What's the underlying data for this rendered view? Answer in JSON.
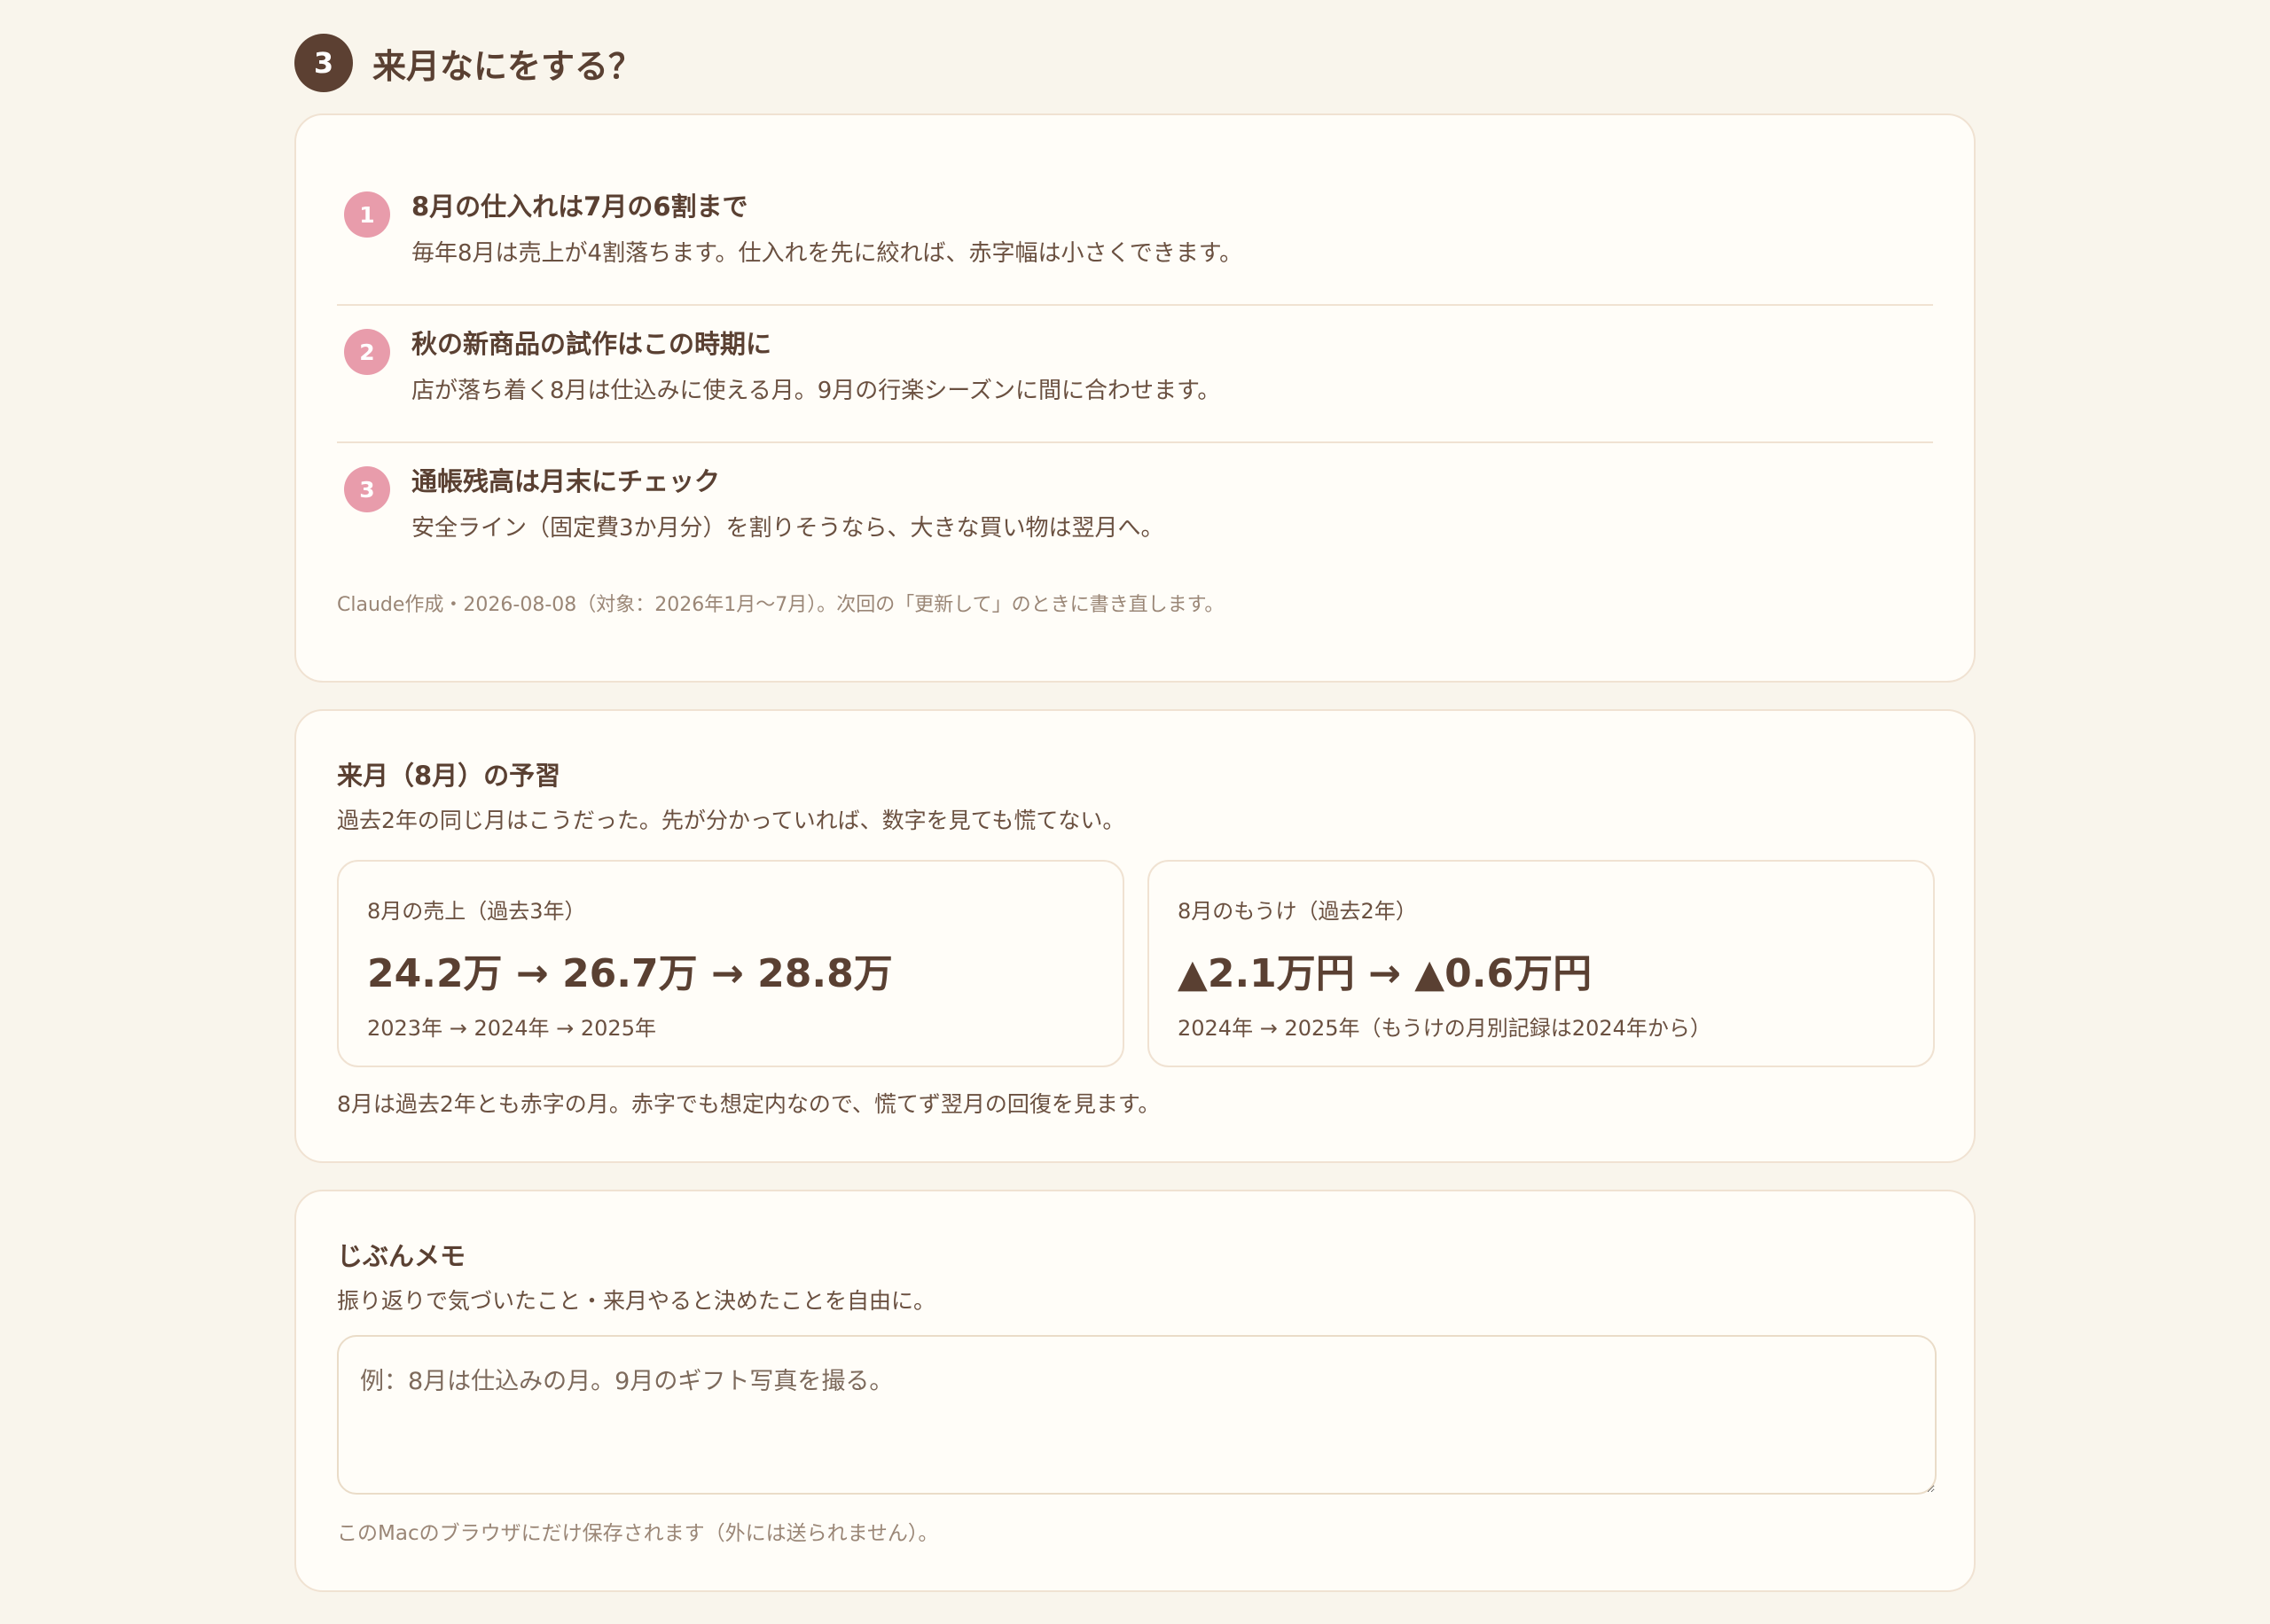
{
  "section": {
    "number": "3",
    "title": "来月なにをする？"
  },
  "advice": {
    "items": [
      {
        "number": "1",
        "title": "8月の仕入れは7月の6割まで",
        "desc": "毎年8月は売上が4割落ちます。仕入れを先に絞れば、赤字幅は小さくできます。"
      },
      {
        "number": "2",
        "title": "秋の新商品の試作はこの時期に",
        "desc": "店が落ち着く8月は仕込みに使える月。9月の行楽シーズンに間に合わせます。"
      },
      {
        "number": "3",
        "title": "通帳残高は月末にチェック",
        "desc": "安全ライン（固定費3か月分）を割りそうなら、大きな買い物は翌月へ。"
      }
    ],
    "footnote": "Claude作成・2026-08-08（対象：2026年1月〜7月）。次回の「更新して」のときに書き直します。"
  },
  "preview": {
    "heading": "来月（8月）の予習",
    "sub": "過去2年の同じ月はこうだった。先が分かっていれば、数字を見ても慌てない。",
    "sales": {
      "label": "8月の売上（過去3年）",
      "value": "24.2万 → 26.7万 → 28.8万",
      "note": "2023年 → 2024年 → 2025年"
    },
    "profit": {
      "label": "8月のもうけ（過去2年）",
      "value": "▲2.1万円 → ▲0.6万円",
      "note": "2024年 → 2025年（もうけの月別記録は2024年から）"
    },
    "note": "8月は過去2年とも赤字の月。赤字でも想定内なので、慌てず翌月の回復を見ます。"
  },
  "memo": {
    "heading": "じぶんメモ",
    "sub": "振り返りで気づいたこと・来月やると決めたことを自由に。",
    "placeholder": "例：8月は仕込みの月。9月のギフト写真を撮る。",
    "value": "",
    "footnote": "このMacのブラウザにだけ保存されます（外には送られません）。"
  }
}
